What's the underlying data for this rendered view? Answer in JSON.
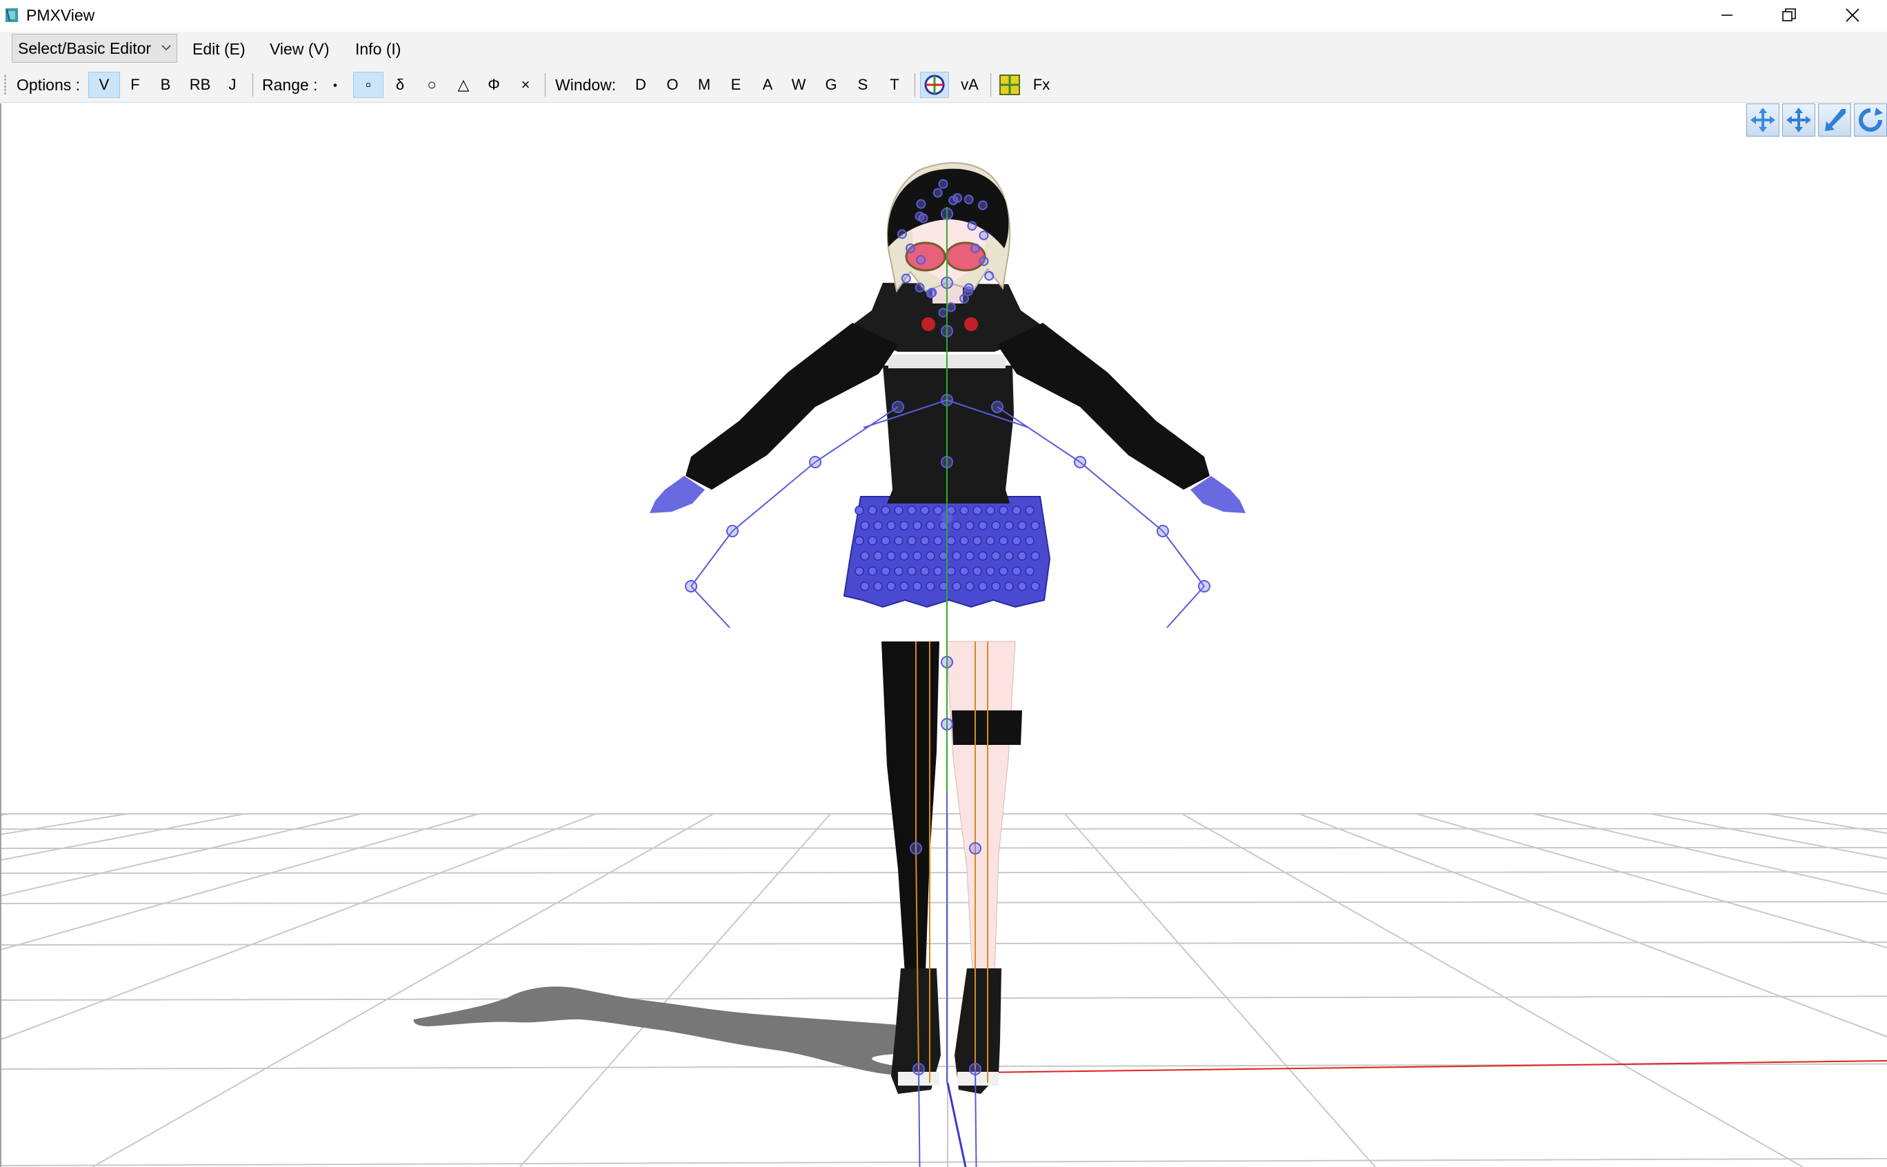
{
  "window": {
    "title": "PMXView",
    "minimize": "minimize",
    "maximize": "restore",
    "close": "close"
  },
  "menubar": {
    "mode_select": "Select/Basic Editor",
    "items": [
      "Edit (E)",
      "View (V)",
      "Info (I)"
    ]
  },
  "toolbar": {
    "options_label": "Options :",
    "options": [
      "V",
      "F",
      "B",
      "RB",
      "J"
    ],
    "options_active": "V",
    "range_label": "Range :",
    "range_buttons": [
      "・",
      "▫",
      "δ",
      "○",
      "△",
      "Φ",
      "×"
    ],
    "range_active": "▫",
    "window_label": "Window:",
    "window_buttons": [
      "D",
      "O",
      "M",
      "E",
      "A",
      "W",
      "G",
      "S",
      "T"
    ],
    "va_label": "vA",
    "fx_label": "Fx"
  },
  "viewport": {
    "tools": [
      "move-xy-icon",
      "move-xz-icon",
      "zoom-icon",
      "rotate-icon"
    ],
    "colors": {
      "bone": "#5a5ad8",
      "ik_bone": "#d88a20",
      "grid": "#c8c8c8",
      "x_axis": "#e02020",
      "shadow": "#7a7a7a"
    }
  }
}
